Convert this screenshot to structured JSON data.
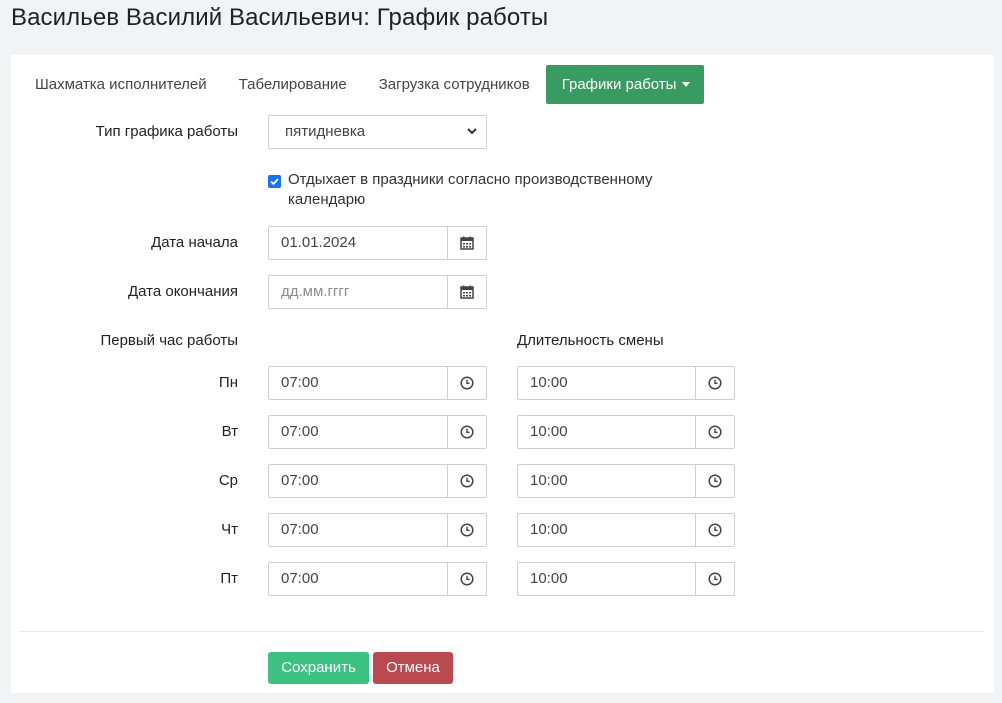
{
  "page": {
    "title": "Васильев Василий Васильевич: График работы"
  },
  "tabs": [
    {
      "label": "Шахматка исполнителей"
    },
    {
      "label": "Табелирование"
    },
    {
      "label": "Загрузка сотрудников"
    },
    {
      "label": "Графики работы"
    }
  ],
  "form": {
    "schedule_type_label": "Тип графика работы",
    "schedule_type_value": "пятидневка",
    "holiday_rest_label": "Отдыхает в праздники согласно производственному календарю",
    "holiday_rest_checked": true,
    "start_date_label": "Дата начала",
    "start_date_value": "01.01.2024",
    "end_date_label": "Дата окончания",
    "end_date_placeholder": "дд.мм.гггг",
    "first_hour_heading": "Первый час работы",
    "duration_heading": "Длительность смены"
  },
  "days": [
    {
      "label": "Пн",
      "start": "07:00",
      "duration": "10:00"
    },
    {
      "label": "Вт",
      "start": "07:00",
      "duration": "10:00"
    },
    {
      "label": "Ср",
      "start": "07:00",
      "duration": "10:00"
    },
    {
      "label": "Чт",
      "start": "07:00",
      "duration": "10:00"
    },
    {
      "label": "Пт",
      "start": "07:00",
      "duration": "10:00"
    }
  ],
  "buttons": {
    "save_label": "Сохранить",
    "cancel_label": "Отмена"
  },
  "colors": {
    "active_tab": "#3a9b62",
    "save_button": "#3cc183",
    "cancel_button": "#b94a4f",
    "checkbox": "#1a73e8"
  },
  "icons": {
    "date_picker": "calendar-icon",
    "time_picker": "clock-icon",
    "select_arrow": "chevron-down-icon",
    "tab_menu": "caret-down-icon"
  }
}
